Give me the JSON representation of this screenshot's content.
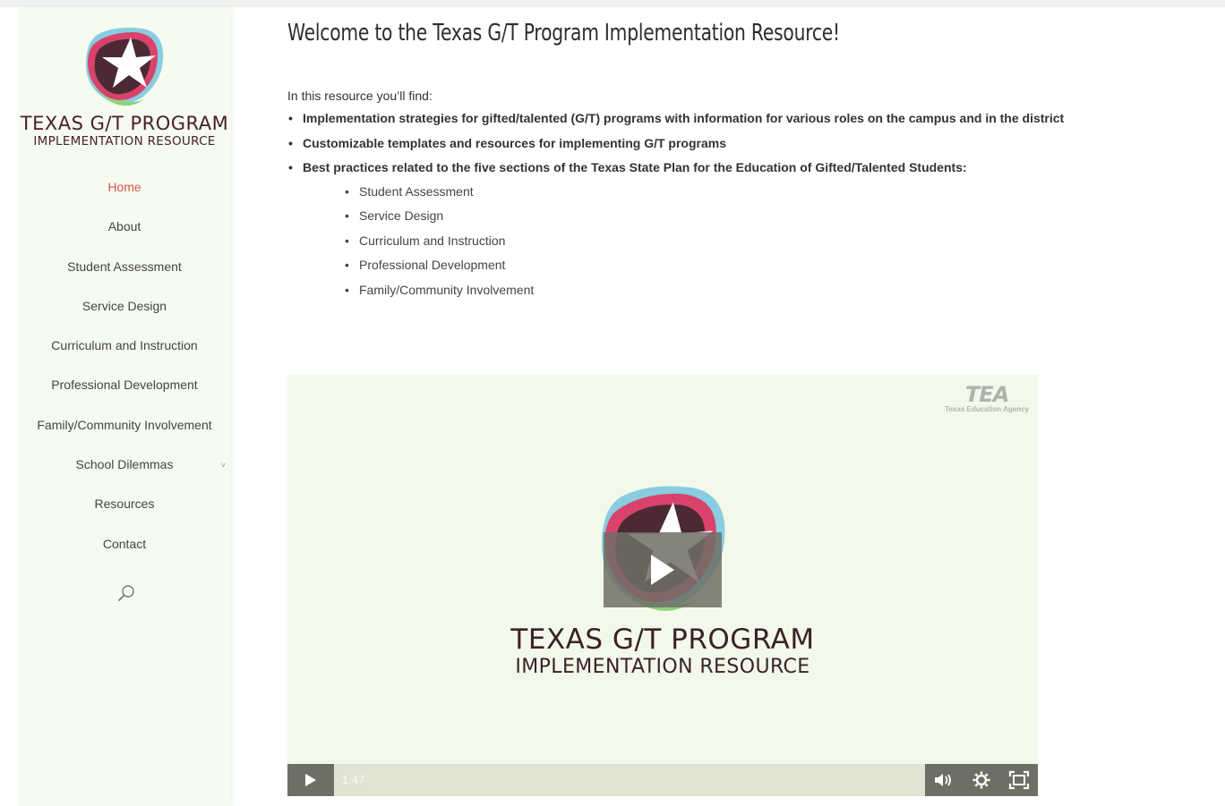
{
  "site": {
    "logo_title": "TEXAS G/T PROGRAM",
    "logo_subtitle": "IMPLEMENTATION RESOURCE"
  },
  "nav": {
    "items": [
      {
        "label": "Home",
        "active": true
      },
      {
        "label": "About"
      },
      {
        "label": "Student Assessment"
      },
      {
        "label": "Service Design"
      },
      {
        "label": "Curriculum and Instruction"
      },
      {
        "label": "Professional Development"
      },
      {
        "label": "Family/Community Involvement"
      },
      {
        "label": "School Dilemmas",
        "has_submenu": true,
        "submenu_icon": "chevron-down-icon"
      },
      {
        "label": "Resources"
      },
      {
        "label": "Contact"
      }
    ],
    "search_icon": "search-icon"
  },
  "main": {
    "title": "Welcome to the Texas G/T Program Implementation Resource!",
    "intro": "In this resource you’ll find:",
    "bullets": [
      "Implementation strategies for gifted/talented (G/T) programs with information for various roles on the campus and in the district",
      "Customizable templates and resources for implementing G/T programs",
      "Best practices related to the five sections of the Texas State Plan for the Education of Gifted/Talented Students:"
    ],
    "sub_bullets": [
      "Student Assessment",
      "Service Design",
      "Curriculum and Instruction",
      "Professional Development",
      "Family/Community Involvement"
    ]
  },
  "video": {
    "brand": "TEA",
    "brand_sub": "Texas Education Agency",
    "title": "TEXAS G/T PROGRAM",
    "subtitle": "IMPLEMENTATION RESOURCE",
    "duration": "1:47",
    "progress": 0,
    "controls": [
      "play-icon",
      "volume-icon",
      "settings-icon",
      "fullscreen-icon"
    ]
  },
  "colors": {
    "sidebar_bg": "#f6fbef",
    "active_nav": "#d9534f",
    "video_bg": "#f3f9ea",
    "control_bar": "#6e6f64",
    "logo_text": "#4a2027"
  }
}
